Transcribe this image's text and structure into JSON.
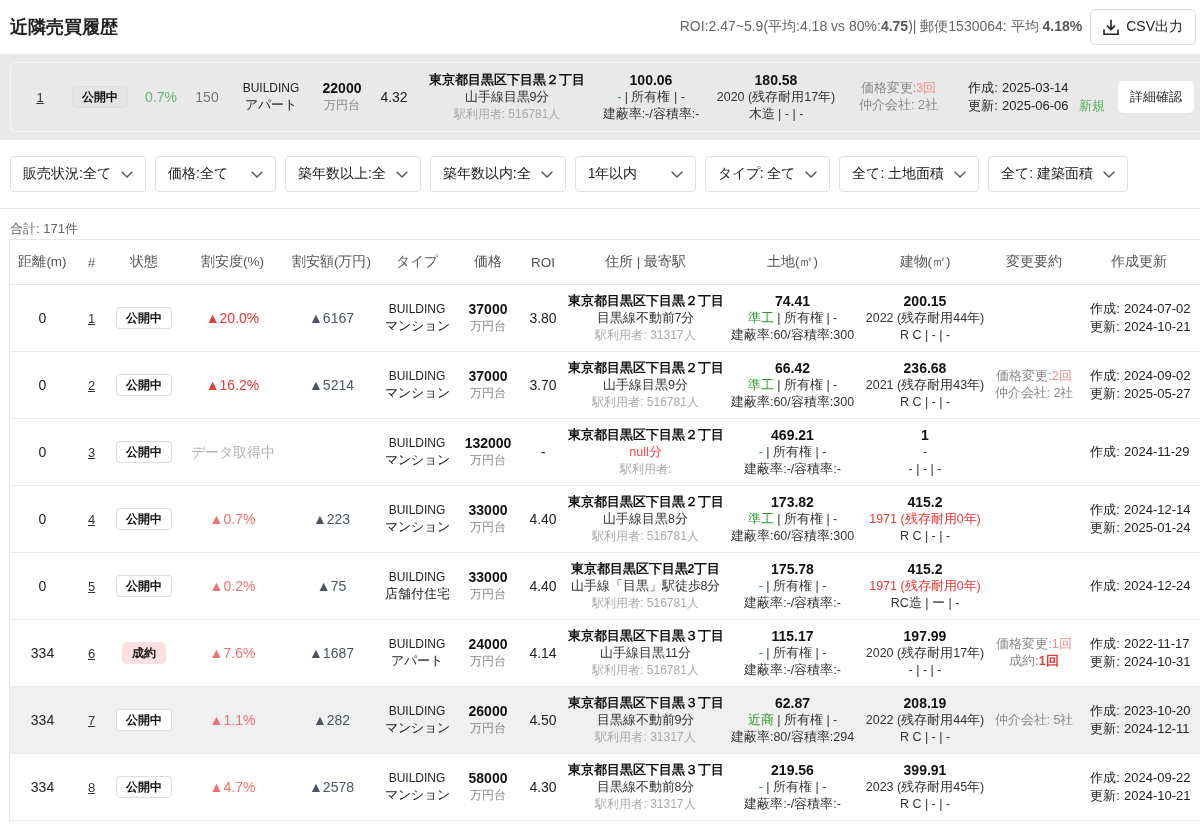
{
  "header": {
    "title": "近隣売買履歴",
    "stats": "ROI:2.47~5.9(平均:4.18 vs 80%:**4.75**)| 郵便1530064: 平均 **4.18%**",
    "csv_button": "CSV出力"
  },
  "featured": {
    "number": "1",
    "status": {
      "label": "公開中",
      "kind": "listed"
    },
    "discount_rate": {
      "text": "0.7%",
      "color": "#5dbb63"
    },
    "discount_amount": {
      "text": "150",
      "color": "#777777"
    },
    "type_code": "BUILDING",
    "type_name": "アパート",
    "price": "22000",
    "price_unit": "万円台",
    "roi": "4.32",
    "address": {
      "line": "東京都目黒区下目黒２丁目",
      "station": "山手線目黒9分",
      "station_error": false,
      "users": "駅利用者: 516781人"
    },
    "land": {
      "area": "100.06",
      "zoning": "-",
      "rights": "| 所有権 | -",
      "ratios": "建蔽率:-/容積率:-"
    },
    "building": {
      "area": "180.58",
      "age": "2020 (残存耐用17年)",
      "expired": false,
      "structure": "木造 | - | -"
    },
    "summary": [
      {
        "kind": "price_change",
        "label": "価格変更:",
        "count": "3回"
      },
      {
        "kind": "agents",
        "label": "仲介会社: 2社"
      }
    ],
    "dates": [
      {
        "label": "作成:",
        "value": "2025-03-14"
      },
      {
        "label": "更新:",
        "value": "2025-06-06",
        "tag": "新規"
      }
    ],
    "detail_button": "詳細確認"
  },
  "filters": [
    {
      "label": "販売状況:全て"
    },
    {
      "label": "価格:全て"
    },
    {
      "label": "築年数以上:全"
    },
    {
      "label": "築年数以内:全"
    },
    {
      "label": "1年以内"
    },
    {
      "label": "タイプ: 全て"
    },
    {
      "label": "全て: 土地面積"
    },
    {
      "label": "全て: 建築面積"
    }
  ],
  "total": "合計: 171件",
  "table": {
    "columns": [
      "距離(m)",
      "#",
      "状態",
      "割安度(%)",
      "割安額(万円)",
      "タイプ",
      "価格",
      "ROI",
      "住所 | 最寄駅",
      "土地(㎡)",
      "建物(㎡)",
      "変更要約",
      "作成更新"
    ],
    "rows": [
      {
        "distance": "0",
        "number": "1",
        "highlighted": false,
        "status": {
          "label": "公開中",
          "kind": "listed"
        },
        "discount_rate": {
          "text": "▲20.0%",
          "color": "#e53935"
        },
        "discount_amount": {
          "text": "▲6167",
          "color": "#4b5563"
        },
        "type_code": "BUILDING",
        "type_name": "マンション",
        "price": "37000",
        "price_unit": "万円台",
        "roi": "3.80",
        "address": {
          "line": "東京都目黒区下目黒２丁目",
          "station": "目黒線不動前7分",
          "station_error": false,
          "users": "駅利用者: 31317人"
        },
        "land": {
          "area": "74.41",
          "zoning": "準工",
          "rights": "| 所有権 | -",
          "ratios": "建蔽率:60/容積率:300"
        },
        "building": {
          "area": "200.15",
          "age": "2022 (残存耐用44年)",
          "expired": false,
          "structure": "R C | - | -"
        },
        "dates": [
          {
            "label": "作成:",
            "value": "2024-07-02"
          },
          {
            "label": "更新:",
            "value": "2024-10-21"
          }
        ]
      },
      {
        "distance": "0",
        "number": "2",
        "highlighted": false,
        "status": {
          "label": "公開中",
          "kind": "listed"
        },
        "discount_rate": {
          "text": "▲16.2%",
          "color": "#e53935"
        },
        "discount_amount": {
          "text": "▲5214",
          "color": "#4b5563"
        },
        "type_code": "BUILDING",
        "type_name": "マンション",
        "price": "37000",
        "price_unit": "万円台",
        "roi": "3.70",
        "address": {
          "line": "東京都目黒区下目黒２丁目",
          "station": "山手線目黒9分",
          "station_error": false,
          "users": "駅利用者: 516781人"
        },
        "land": {
          "area": "66.42",
          "zoning": "準工",
          "rights": "| 所有権 | -",
          "ratios": "建蔽率:60/容積率:300"
        },
        "building": {
          "area": "236.68",
          "age": "2021 (残存耐用43年)",
          "expired": false,
          "structure": "R C | - | -"
        },
        "summary": [
          {
            "kind": "price_change",
            "label": "価格変更:",
            "count": "2回"
          },
          {
            "kind": "agents",
            "label": "仲介会社: 2社"
          }
        ],
        "dates": [
          {
            "label": "作成:",
            "value": "2024-09-02"
          },
          {
            "label": "更新:",
            "value": "2025-05-27"
          }
        ]
      },
      {
        "distance": "0",
        "number": "3",
        "highlighted": false,
        "status": {
          "label": "公開中",
          "kind": "listed"
        },
        "discount_rate": {
          "text": "データ取得中",
          "color": "#b3b3b3"
        },
        "type_code": "BUILDING",
        "type_name": "マンション",
        "price": "132000",
        "price_unit": "万円台",
        "roi": "-",
        "address": {
          "line": "東京都目黒区下目黒２丁目",
          "station": "null分",
          "station_error": true,
          "users": "駅利用者:"
        },
        "land": {
          "area": "469.21",
          "zoning": "-",
          "rights": "| 所有権 | -",
          "ratios": "建蔽率:-/容積率:-"
        },
        "building": {
          "area": "1",
          "age": "-",
          "expired": false,
          "structure": "- | - | -"
        },
        "dates": [
          {
            "label": "作成:",
            "value": "2024-11-29"
          }
        ]
      },
      {
        "distance": "0",
        "number": "4",
        "highlighted": false,
        "status": {
          "label": "公開中",
          "kind": "listed"
        },
        "discount_rate": {
          "text": "▲0.7%",
          "color": "#f07171"
        },
        "discount_amount": {
          "text": "▲223",
          "color": "#4b5563"
        },
        "type_code": "BUILDING",
        "type_name": "マンション",
        "price": "33000",
        "price_unit": "万円台",
        "roi": "4.40",
        "address": {
          "line": "東京都目黒区下目黒２丁目",
          "station": "山手線目黒8分",
          "station_error": false,
          "users": "駅利用者: 516781人"
        },
        "land": {
          "area": "173.82",
          "zoning": "準工",
          "rights": "| 所有権 | -",
          "ratios": "建蔽率:60/容積率:300"
        },
        "building": {
          "area": "415.2",
          "age": "1971 (残存耐用0年)",
          "expired": true,
          "structure": "R C | - | -"
        },
        "dates": [
          {
            "label": "作成:",
            "value": "2024-12-14"
          },
          {
            "label": "更新:",
            "value": "2025-01-24"
          }
        ]
      },
      {
        "distance": "0",
        "number": "5",
        "highlighted": false,
        "status": {
          "label": "公開中",
          "kind": "listed"
        },
        "discount_rate": {
          "text": "▲0.2%",
          "color": "#f07171"
        },
        "discount_amount": {
          "text": "▲75",
          "color": "#4b5563"
        },
        "type_code": "BUILDING",
        "type_name": "店舗付住宅",
        "price": "33000",
        "price_unit": "万円台",
        "roi": "4.40",
        "address": {
          "line": "東京都目黒区下目黒2丁目",
          "station": "山手線「目黒」駅徒歩8分",
          "station_error": false,
          "users": "駅利用者: 516781人"
        },
        "land": {
          "area": "175.78",
          "zoning": "-",
          "rights": "| 所有権 | -",
          "ratios": "建蔽率:-/容積率:-"
        },
        "building": {
          "area": "415.2",
          "age": "1971 (残存耐用0年)",
          "expired": true,
          "structure": "RC造 | ー | -"
        },
        "dates": [
          {
            "label": "作成:",
            "value": "2024-12-24"
          }
        ]
      },
      {
        "distance": "334",
        "number": "6",
        "highlighted": false,
        "status": {
          "label": "成約",
          "kind": "contracted"
        },
        "discount_rate": {
          "text": "▲7.6%",
          "color": "#f07171"
        },
        "discount_amount": {
          "text": "▲1687",
          "color": "#4b5563"
        },
        "type_code": "BUILDING",
        "type_name": "アパート",
        "price": "24000",
        "price_unit": "万円台",
        "roi": "4.14",
        "address": {
          "line": "東京都目黒区下目黒３丁目",
          "station": "山手線目黒11分",
          "station_error": false,
          "users": "駅利用者: 516781人"
        },
        "land": {
          "area": "115.17",
          "zoning": "-",
          "rights": "| 所有権 | -",
          "ratios": "建蔽率:-/容積率:-"
        },
        "building": {
          "area": "197.99",
          "age": "2020 (残存耐用17年)",
          "expired": false,
          "structure": "- | - | -"
        },
        "summary": [
          {
            "kind": "price_change",
            "label": "価格変更:",
            "count": "1回"
          },
          {
            "kind": "contract",
            "label": "成約:",
            "count": "1回"
          }
        ],
        "dates": [
          {
            "label": "作成:",
            "value": "2022-11-17"
          },
          {
            "label": "更新:",
            "value": "2024-10-31"
          }
        ]
      },
      {
        "distance": "334",
        "number": "7",
        "highlighted": true,
        "status": {
          "label": "公開中",
          "kind": "listed"
        },
        "discount_rate": {
          "text": "▲1.1%",
          "color": "#f07171"
        },
        "discount_amount": {
          "text": "▲282",
          "color": "#4b5563"
        },
        "type_code": "BUILDING",
        "type_name": "マンション",
        "price": "26000",
        "price_unit": "万円台",
        "roi": "4.50",
        "address": {
          "line": "東京都目黒区下目黒３丁目",
          "station": "目黒線不動前9分",
          "station_error": false,
          "users": "駅利用者: 31317人"
        },
        "land": {
          "area": "62.87",
          "zoning": "近商",
          "rights": "| 所有権 | -",
          "ratios": "建蔽率:80/容積率:294"
        },
        "building": {
          "area": "208.19",
          "age": "2022 (残存耐用44年)",
          "expired": false,
          "structure": "R C | - | -"
        },
        "summary": [
          {
            "kind": "agents",
            "label": "仲介会社: 5社"
          }
        ],
        "dates": [
          {
            "label": "作成:",
            "value": "2023-10-20"
          },
          {
            "label": "更新:",
            "value": "2024-12-11"
          }
        ]
      },
      {
        "distance": "334",
        "number": "8",
        "highlighted": false,
        "status": {
          "label": "公開中",
          "kind": "listed"
        },
        "discount_rate": {
          "text": "▲4.7%",
          "color": "#f07171"
        },
        "discount_amount": {
          "text": "▲2578",
          "color": "#4b5563"
        },
        "type_code": "BUILDING",
        "type_name": "マンション",
        "price": "58000",
        "price_unit": "万円台",
        "roi": "4.30",
        "address": {
          "line": "東京都目黒区下目黒３丁目",
          "station": "目黒線不動前8分",
          "station_error": false,
          "users": "駅利用者: 31317人"
        },
        "land": {
          "area": "219.56",
          "zoning": "-",
          "rights": "| 所有権 | -",
          "ratios": "建蔽率:-/容積率:-"
        },
        "building": {
          "area": "399.91",
          "age": "2023 (残存耐用45年)",
          "expired": false,
          "structure": "R C | - | -"
        },
        "dates": [
          {
            "label": "作成:",
            "value": "2024-09-22"
          },
          {
            "label": "更新:",
            "value": "2024-10-21"
          }
        ]
      }
    ]
  }
}
